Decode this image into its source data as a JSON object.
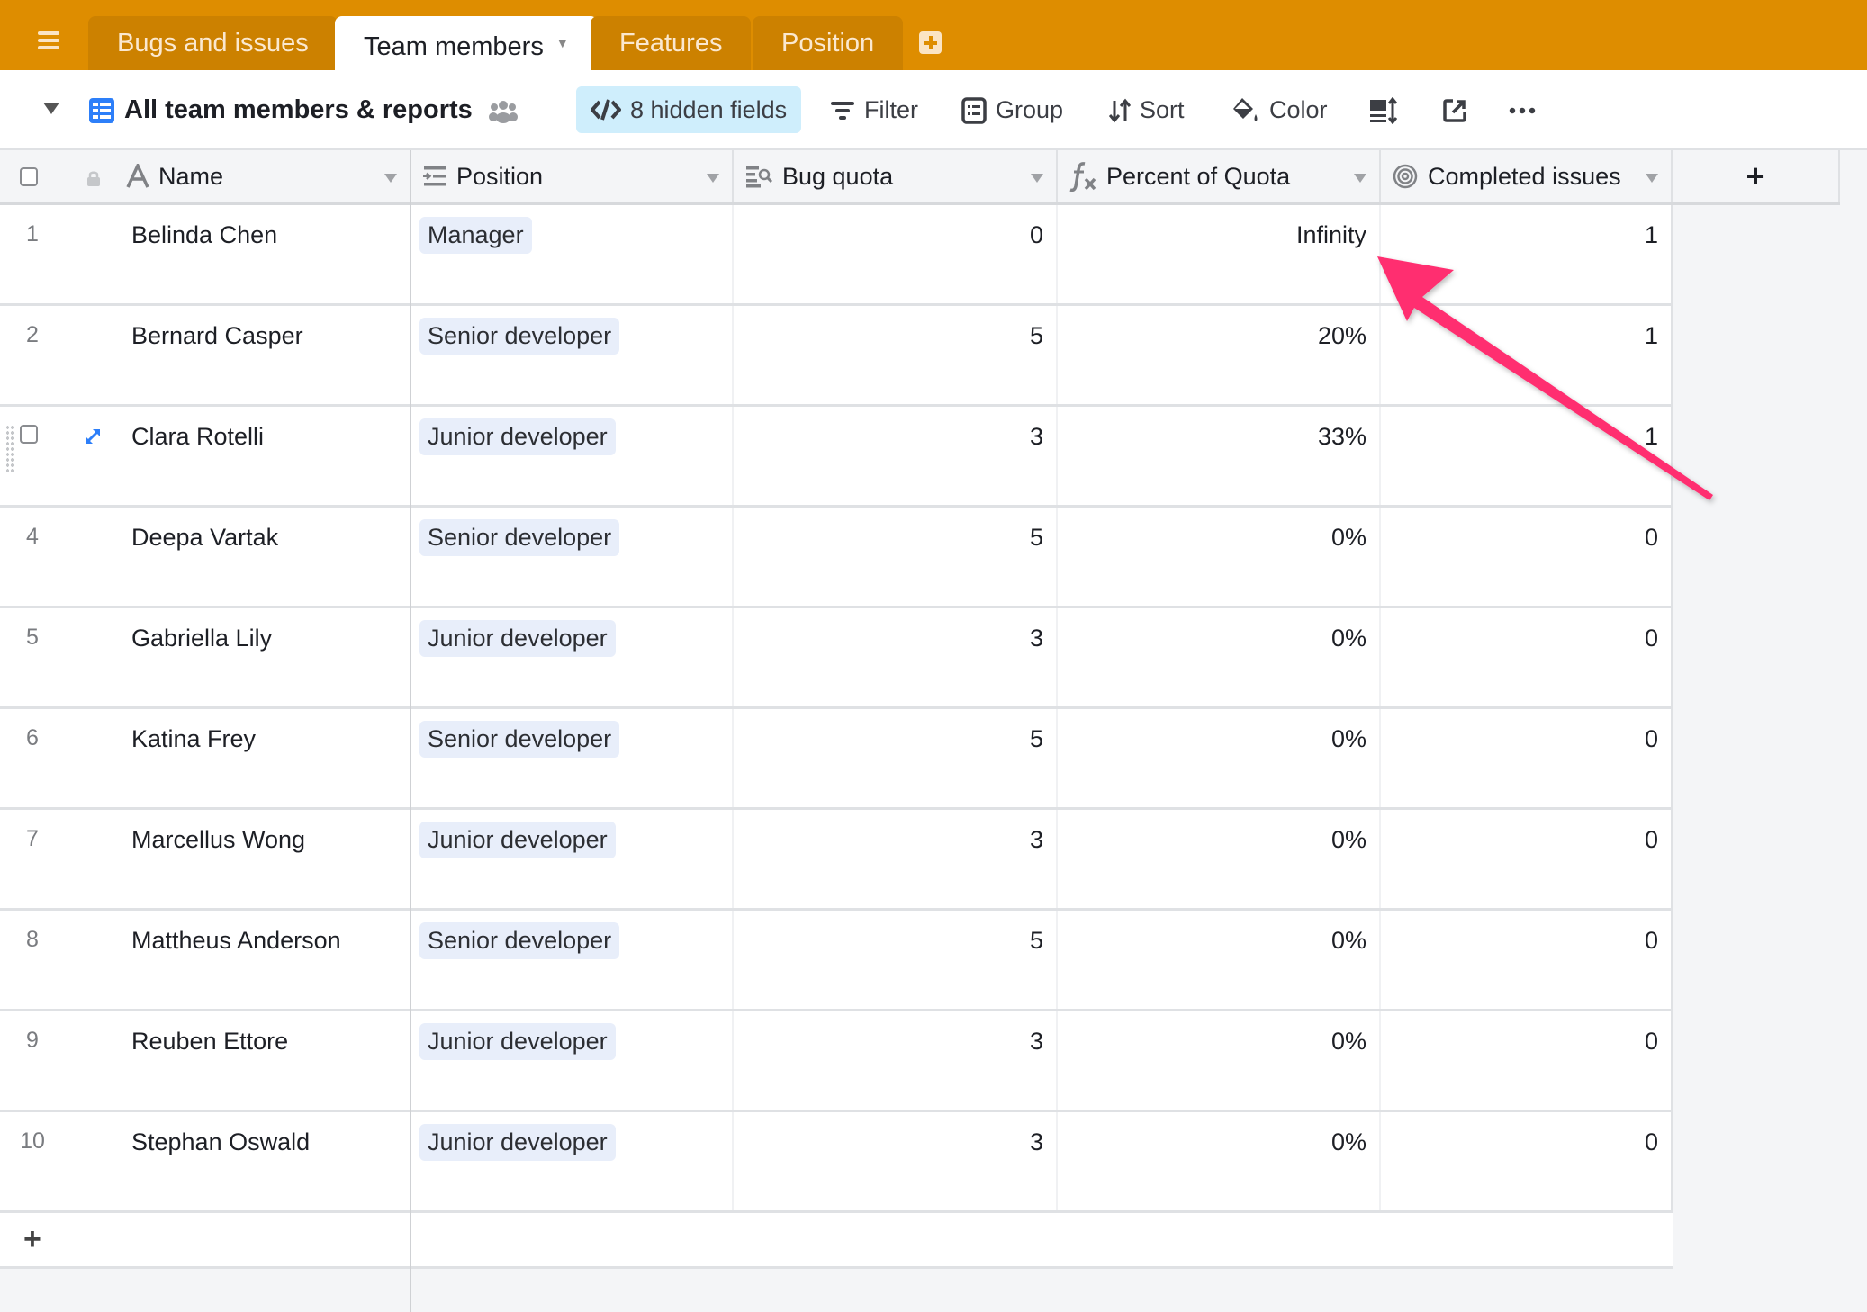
{
  "tabs": [
    {
      "label": "Bugs and issues",
      "active": false
    },
    {
      "label": "Team members",
      "active": true
    },
    {
      "label": "Features",
      "active": false
    },
    {
      "label": "Position",
      "active": false
    }
  ],
  "toolbar": {
    "view_name": "All team members & reports",
    "hidden_fields": "8 hidden fields",
    "filter": "Filter",
    "group": "Group",
    "sort": "Sort",
    "color": "Color"
  },
  "columns": [
    {
      "label": "Name",
      "icon": "text-icon"
    },
    {
      "label": "Position",
      "icon": "link-record-icon"
    },
    {
      "label": "Bug quota",
      "icon": "lookup-icon"
    },
    {
      "label": "Percent of Quota",
      "icon": "formula-icon"
    },
    {
      "label": "Completed issues",
      "icon": "rollup-icon"
    }
  ],
  "add_column_label": "+",
  "add_row_label": "+",
  "rows": [
    {
      "num": "1",
      "name": "Belinda Chen",
      "position": "Manager",
      "bug_quota": "0",
      "percent": "Infinity",
      "completed": "1"
    },
    {
      "num": "2",
      "name": "Bernard Casper",
      "position": "Senior developer",
      "bug_quota": "5",
      "percent": "20%",
      "completed": "1"
    },
    {
      "num": "3",
      "name": "Clara Rotelli",
      "position": "Junior developer",
      "bug_quota": "3",
      "percent": "33%",
      "completed": "1"
    },
    {
      "num": "4",
      "name": "Deepa Vartak",
      "position": "Senior developer",
      "bug_quota": "5",
      "percent": "0%",
      "completed": "0"
    },
    {
      "num": "5",
      "name": "Gabriella Lily",
      "position": "Junior developer",
      "bug_quota": "3",
      "percent": "0%",
      "completed": "0"
    },
    {
      "num": "6",
      "name": "Katina Frey",
      "position": "Senior developer",
      "bug_quota": "5",
      "percent": "0%",
      "completed": "0"
    },
    {
      "num": "7",
      "name": "Marcellus Wong",
      "position": "Junior developer",
      "bug_quota": "3",
      "percent": "0%",
      "completed": "0"
    },
    {
      "num": "8",
      "name": "Mattheus Anderson",
      "position": "Senior developer",
      "bug_quota": "5",
      "percent": "0%",
      "completed": "0"
    },
    {
      "num": "9",
      "name": "Reuben Ettore",
      "position": "Junior developer",
      "bug_quota": "3",
      "percent": "0%",
      "completed": "0"
    },
    {
      "num": "10",
      "name": "Stephan Oswald",
      "position": "Junior developer",
      "bug_quota": "3",
      "percent": "0%",
      "completed": "0"
    }
  ],
  "hovered_row": 3,
  "colors": {
    "topbar": "#de8d00",
    "annotation_arrow": "#ff2d6f",
    "hidden_fields_bg": "#cfeefc",
    "pill_bg": "#e8eefa"
  }
}
